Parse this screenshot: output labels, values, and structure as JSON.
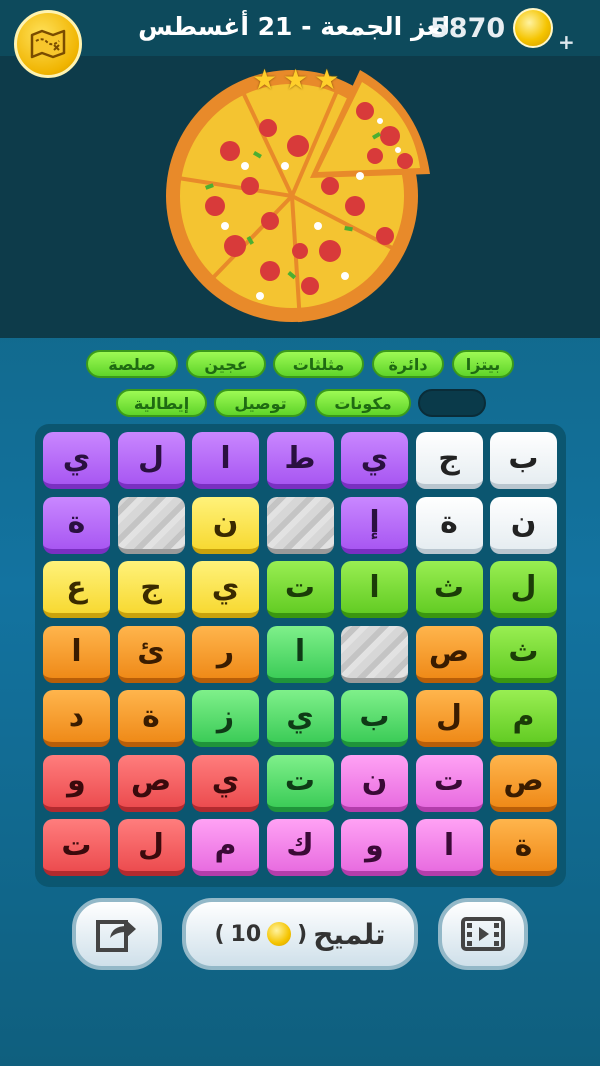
{
  "header": {
    "title": "لغز الجمعة - 21 أغسطس",
    "coins": "5870",
    "plus": "+"
  },
  "icons": {
    "map": "map-icon",
    "coin": "coin-icon",
    "share": "share-icon",
    "video": "video-icon",
    "star": "star-icon"
  },
  "puzzle": {
    "stars": [
      "★",
      "★",
      "★"
    ]
  },
  "words": [
    {
      "text": "بيتزا",
      "found": true
    },
    {
      "text": "دائرة",
      "found": true
    },
    {
      "text": "مثلثات",
      "found": true
    },
    {
      "text": "عجين",
      "found": true
    },
    {
      "text": "صلصة",
      "found": true
    },
    {
      "text": "",
      "found": false
    },
    {
      "text": "مكونات",
      "found": true
    },
    {
      "text": "توصيل",
      "found": true
    },
    {
      "text": "إيطالية",
      "found": true
    }
  ],
  "board": {
    "rows": [
      [
        "ي",
        "ل",
        "ا",
        "ط",
        "ي",
        "ج",
        "ب"
      ],
      [
        "ة",
        "",
        "ن",
        "",
        "إ",
        "ة",
        "ن"
      ],
      [
        "ع",
        "ج",
        "ي",
        "ت",
        "ا",
        "ث",
        "ل"
      ],
      [
        "ا",
        "ئ",
        "ر",
        "ا",
        "",
        "ص",
        "ث"
      ],
      [
        "د",
        "ة",
        "ز",
        "ي",
        "ب",
        "ل",
        "م"
      ],
      [
        "و",
        "ص",
        "ي",
        "ت",
        "ن",
        "ت",
        "ص"
      ],
      [
        "ت",
        "ل",
        "م",
        "ك",
        "و",
        "ا",
        "ة"
      ]
    ],
    "colors": [
      [
        "purple",
        "purple",
        "purple",
        "purple",
        "purple",
        "white",
        "white"
      ],
      [
        "purple",
        "stone",
        "yellow",
        "stone",
        "purple",
        "white",
        "white"
      ],
      [
        "yellow",
        "yellow",
        "yellow",
        "lgreen",
        "lgreen",
        "lgreen",
        "lgreen"
      ],
      [
        "orange",
        "orange",
        "orange",
        "green",
        "stone",
        "orange",
        "lgreen"
      ],
      [
        "orange",
        "orange",
        "green",
        "green",
        "green",
        "orange",
        "lgreen"
      ],
      [
        "red",
        "red",
        "red",
        "green",
        "pink",
        "pink",
        "orange"
      ],
      [
        "red",
        "red",
        "pink",
        "pink",
        "pink",
        "pink",
        "orange"
      ]
    ]
  },
  "hint": {
    "label": "تلميح",
    "cost_open": "(",
    "cost": "10",
    "cost_close": ")"
  },
  "colors": {
    "header_bg": "#0d4a5c",
    "found_word": "#6fe233",
    "accent_coin": "#f5c400"
  }
}
